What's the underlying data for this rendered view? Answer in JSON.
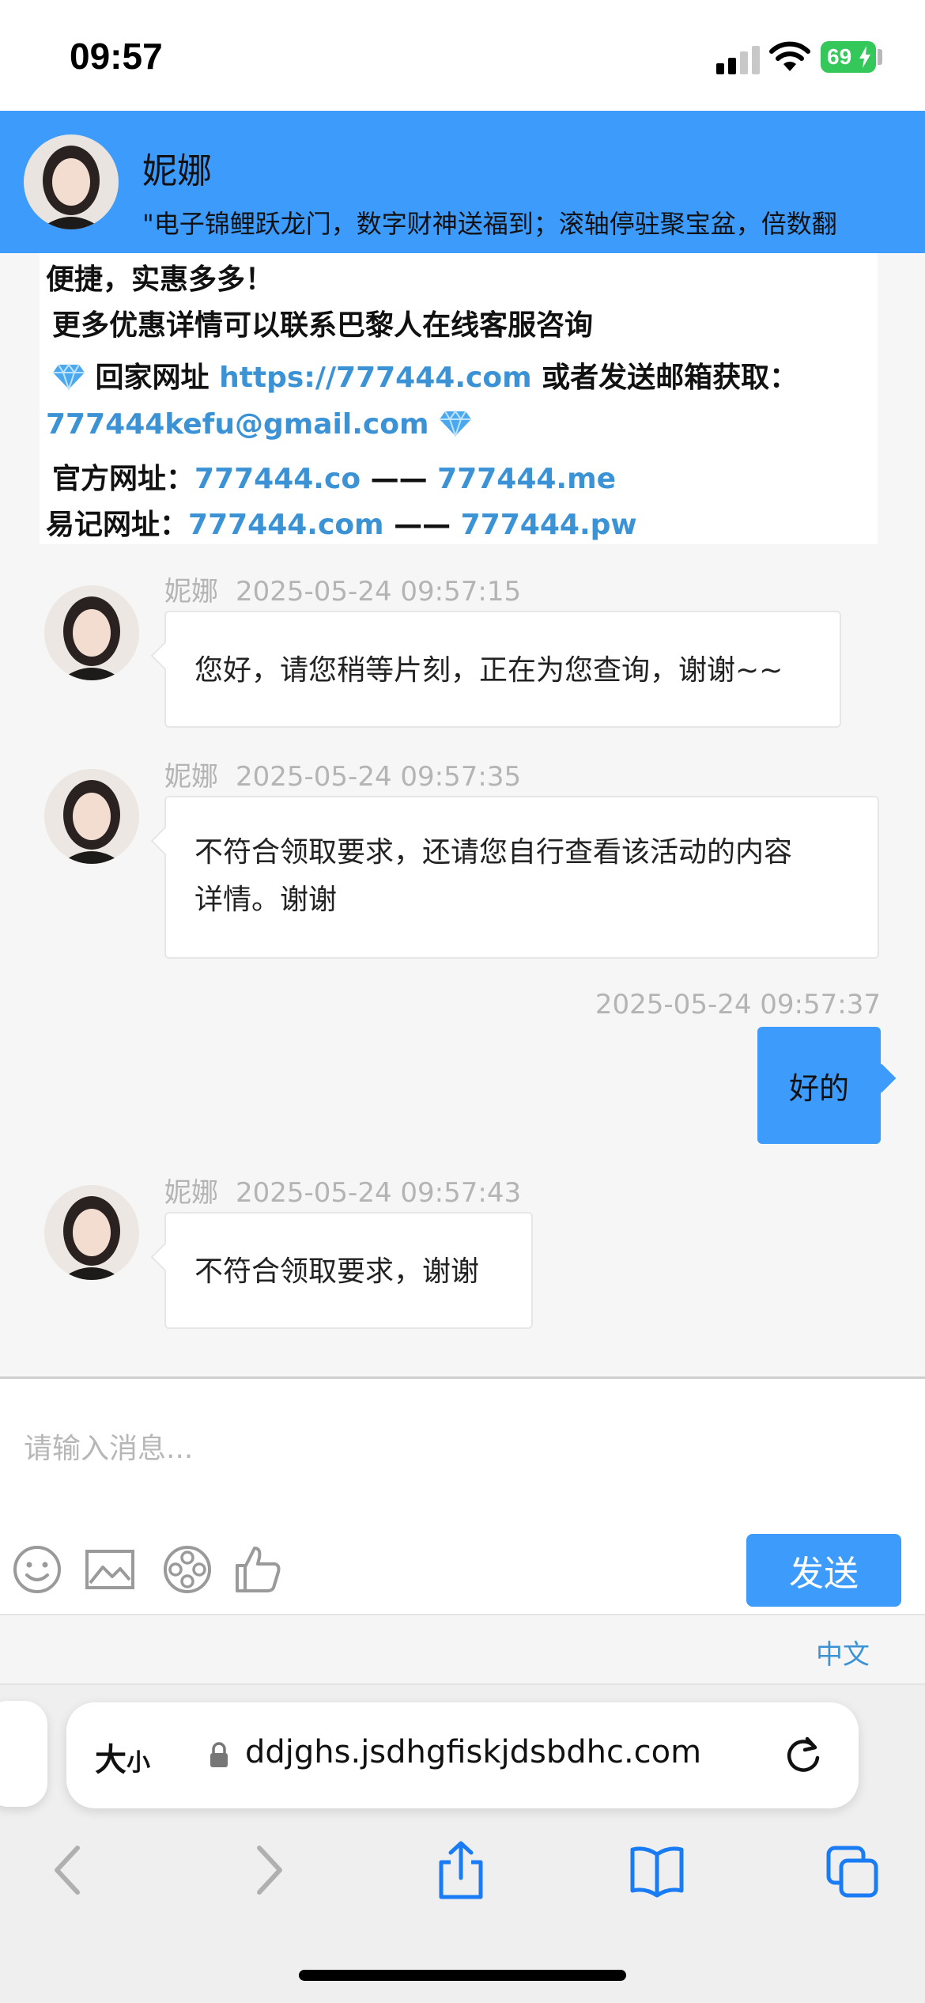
{
  "status_bar": {
    "time": "09:57",
    "battery": "69"
  },
  "header": {
    "agent_name": "妮娜",
    "marquee": "\"电子锦鲤跃龙门，数字财神送福到；滚轴停驻聚宝盆，倍数翻"
  },
  "announcement": {
    "line1": "便捷，实惠多多！",
    "line2": "更多优惠详情可以联系巴黎人在线客服咨询",
    "line3_prefix": "回家网址 ",
    "line3_link": "https://777444.com",
    "line3_suffix": " 或者发送邮箱获取：",
    "email": "777444kefu@gmail.com",
    "official_label": "官方网址：",
    "official_link1": "777444.co",
    "official_dash": " —— ",
    "official_link2": "777444.me",
    "easy_label": "易记网址：",
    "easy_link1": "777444.com",
    "easy_dash": " —— ",
    "easy_link2": "777444.pw"
  },
  "messages": [
    {
      "sender": "妮娜",
      "time": "2025-05-24 09:57:15",
      "text": "您好，请您稍等片刻，正在为您查询，谢谢~~"
    },
    {
      "sender": "妮娜",
      "time": "2025-05-24 09:57:35",
      "text_line1": "不符合领取要求，还请您自行查看该活动的内容",
      "text_line2": "详情。谢谢"
    },
    {
      "sender": "",
      "time": "2025-05-24 09:57:37",
      "text": "好的",
      "self": true
    },
    {
      "sender": "妮娜",
      "time": "2025-05-24 09:57:43",
      "text": "不符合领取要求，谢谢"
    }
  ],
  "composer": {
    "placeholder": "请输入消息...",
    "send_label": "发送",
    "tools": [
      "emoji-icon",
      "image-icon",
      "film-reel-icon",
      "thumbs-up-icon"
    ]
  },
  "language": {
    "label": "中文"
  },
  "browser": {
    "text_size_big": "大",
    "text_size_small": "小",
    "url": "ddjghs.jsdhgfiskjdsbdhc.com"
  },
  "colors": {
    "accent": "#3d9bfb",
    "link": "#3b93d6",
    "battery": "#34c759"
  }
}
